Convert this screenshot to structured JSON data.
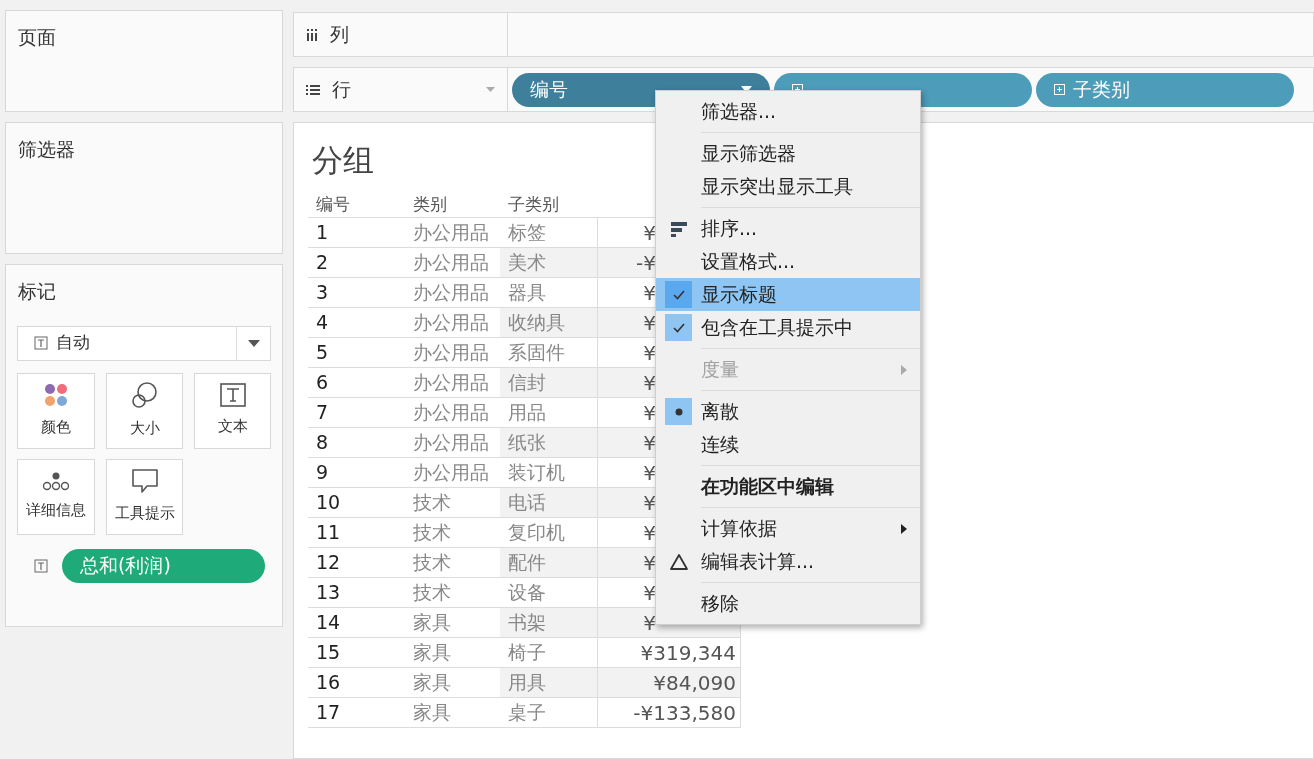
{
  "pages_panel": {
    "title": "页面"
  },
  "filters_panel": {
    "title": "筛选器"
  },
  "marks_panel": {
    "title": "标记",
    "mark_type": "自动",
    "cards": [
      {
        "kind": "color",
        "label": "颜色"
      },
      {
        "kind": "size",
        "label": "大小"
      },
      {
        "kind": "text",
        "label": "文本"
      },
      {
        "kind": "detail",
        "label": "详细信息"
      },
      {
        "kind": "tooltip",
        "label": "工具提示"
      }
    ],
    "fields": [
      {
        "label": "总和(利润)"
      }
    ]
  },
  "columns_shelf": {
    "label": "列"
  },
  "rows_shelf": {
    "label": "行",
    "pills": [
      {
        "label": "编号",
        "selected": true
      },
      {
        "selected": false
      },
      {
        "label": "子类别",
        "selected": false
      }
    ]
  },
  "view": {
    "title": "分组",
    "columns": [
      "编号",
      "类别",
      "子类别"
    ],
    "rows": [
      {
        "id": "1",
        "category": "办公用品",
        "subcategory": "标签",
        "value": "¥",
        "kind": "cut"
      },
      {
        "id": "2",
        "category": "办公用品",
        "subcategory": "美术",
        "value": "-¥",
        "kind": "cut"
      },
      {
        "id": "3",
        "category": "办公用品",
        "subcategory": "器具",
        "value": "¥",
        "kind": "cut"
      },
      {
        "id": "4",
        "category": "办公用品",
        "subcategory": "收纳具",
        "value": "¥",
        "kind": "cut"
      },
      {
        "id": "5",
        "category": "办公用品",
        "subcategory": "系固件",
        "value": "¥",
        "kind": "cut"
      },
      {
        "id": "6",
        "category": "办公用品",
        "subcategory": "信封",
        "value": "¥",
        "kind": "cut"
      },
      {
        "id": "7",
        "category": "办公用品",
        "subcategory": "用品",
        "value": "¥",
        "kind": "cut"
      },
      {
        "id": "8",
        "category": "办公用品",
        "subcategory": "纸张",
        "value": "¥",
        "kind": "cut"
      },
      {
        "id": "9",
        "category": "办公用品",
        "subcategory": "装订机",
        "value": "¥",
        "kind": "cut"
      },
      {
        "id": "10",
        "category": "技术",
        "subcategory": "电话",
        "value": "¥",
        "kind": "cut"
      },
      {
        "id": "11",
        "category": "技术",
        "subcategory": "复印机",
        "value": "¥",
        "kind": "cut"
      },
      {
        "id": "12",
        "category": "技术",
        "subcategory": "配件",
        "value": "¥",
        "kind": "cut"
      },
      {
        "id": "13",
        "category": "技术",
        "subcategory": "设备",
        "value": "¥",
        "kind": "cut"
      },
      {
        "id": "14",
        "category": "家具",
        "subcategory": "书架",
        "value": "¥",
        "kind": "cut"
      },
      {
        "id": "15",
        "category": "家具",
        "subcategory": "椅子",
        "value": "¥319,344",
        "kind": "full"
      },
      {
        "id": "16",
        "category": "家具",
        "subcategory": "用具",
        "value": "¥84,090",
        "kind": "full"
      },
      {
        "id": "17",
        "category": "家具",
        "subcategory": "桌子",
        "value": "-¥133,580",
        "kind": "full"
      }
    ]
  },
  "context_menu": {
    "groups": [
      [
        {
          "label": "筛选器...",
          "kind": "plain",
          "checked": false,
          "selected": false,
          "disabled": false,
          "bold": false
        }
      ],
      [
        {
          "label": "显示筛选器",
          "kind": "plain",
          "checked": false,
          "selected": false,
          "disabled": false,
          "bold": false
        },
        {
          "label": "显示突出显示工具",
          "kind": "plain",
          "checked": false,
          "selected": false,
          "disabled": false,
          "bold": false
        }
      ],
      [
        {
          "label": "排序...",
          "kind": "sort",
          "checked": false,
          "selected": false,
          "disabled": false,
          "bold": false
        },
        {
          "label": "设置格式...",
          "kind": "plain",
          "checked": false,
          "selected": false,
          "disabled": false,
          "bold": false
        },
        {
          "label": "显示标题",
          "kind": "check",
          "checked": true,
          "selected": true,
          "disabled": false,
          "bold": false
        },
        {
          "label": "包含在工具提示中",
          "kind": "check",
          "checked": true,
          "selected": false,
          "disabled": false,
          "bold": false
        }
      ],
      [
        {
          "label": "度量",
          "kind": "submenu",
          "checked": false,
          "selected": false,
          "disabled": true,
          "bold": false
        }
      ],
      [
        {
          "label": "离散",
          "kind": "radio",
          "checked": true,
          "selected": false,
          "disabled": false,
          "bold": false
        },
        {
          "label": "连续",
          "kind": "radio",
          "checked": false,
          "selected": false,
          "disabled": false,
          "bold": false
        }
      ],
      [
        {
          "label": "在功能区中编辑",
          "kind": "plain",
          "checked": false,
          "selected": false,
          "disabled": false,
          "bold": true
        }
      ],
      [
        {
          "label": "计算依据",
          "kind": "submenu",
          "checked": false,
          "selected": false,
          "disabled": false,
          "bold": false
        },
        {
          "label": "编辑表计算...",
          "kind": "delta",
          "checked": false,
          "selected": false,
          "disabled": false,
          "bold": false
        }
      ],
      [
        {
          "label": "移除",
          "kind": "plain",
          "checked": false,
          "selected": false,
          "disabled": false,
          "bold": false
        }
      ]
    ]
  }
}
